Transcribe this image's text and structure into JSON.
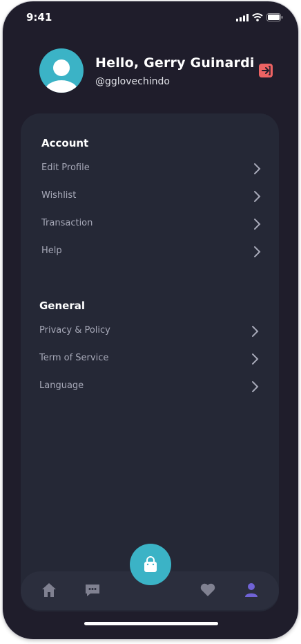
{
  "status": {
    "time": "9:41"
  },
  "profile": {
    "greeting": "Hello, Gerry Guinardi",
    "username": "@gglovechindo"
  },
  "account": {
    "title": "Account",
    "items": [
      "Edit Profile",
      "Wishlist",
      "Transaction",
      "Help"
    ]
  },
  "general": {
    "title": "General",
    "items": [
      "Privacy & Policy",
      "Term of Service",
      "Language"
    ]
  },
  "colors": {
    "background": "#1f1d2b",
    "card": "#252836",
    "accent": "#3bb3c6",
    "logout": "#ed6363",
    "active_nav": "#7063d6"
  },
  "nav": {
    "items": [
      "home-icon",
      "chat-icon",
      "cart-icon",
      "heart-icon",
      "profile-icon"
    ],
    "active": "profile-icon"
  }
}
